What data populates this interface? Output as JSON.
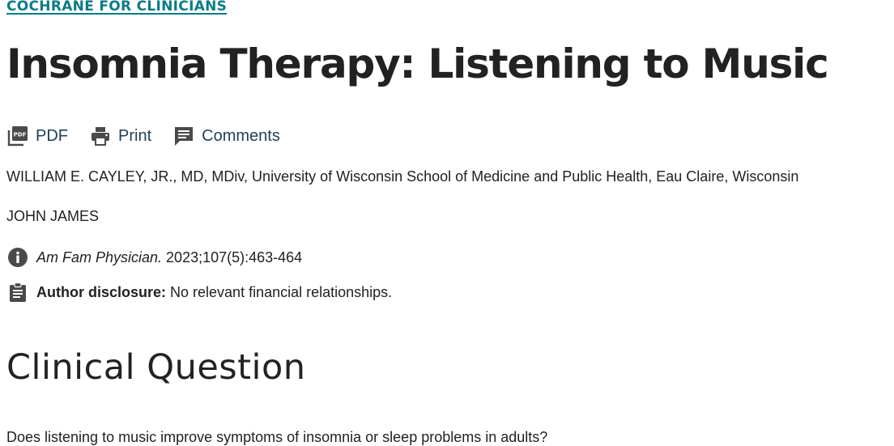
{
  "category": {
    "label": "COCHRANE FOR CLINICIANS"
  },
  "article": {
    "title": "Insomnia Therapy: Listening to Music"
  },
  "tools": {
    "pdf_label": "PDF",
    "print_label": "Print",
    "comments_label": "Comments",
    "pdf_icon_text": "PDF"
  },
  "authors": [
    {
      "text": "WILLIAM E. CAYLEY, JR., MD, MDiv, University of Wisconsin School of Medicine and Public Health, Eau Claire, Wisconsin"
    },
    {
      "text": "JOHN JAMES"
    }
  ],
  "citation": {
    "journal": "Am Fam Physician.",
    "reference": " 2023;107(5):463-464",
    "icon": "info-icon"
  },
  "disclosure": {
    "label": "Author disclosure:",
    "text": " No relevant financial relationships.",
    "icon": "clipboard-icon"
  },
  "section": {
    "heading": "Clinical Question",
    "question": "Does listening to music improve symptoms of insomnia or sleep problems in adults?"
  },
  "colors": {
    "category_link": "#0b7c86",
    "tool_text": "#1e3f57",
    "icon_gray": "#4a4a4a",
    "body_text": "#222222"
  }
}
